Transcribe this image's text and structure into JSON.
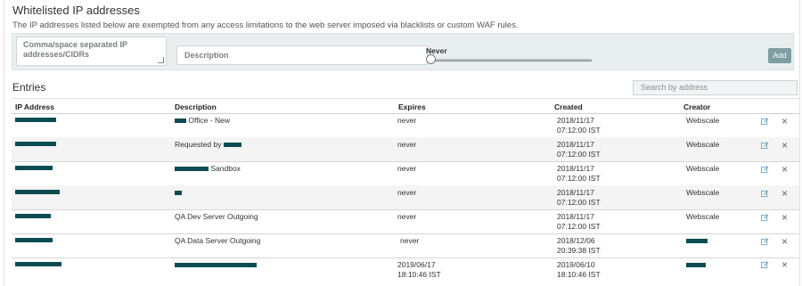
{
  "header": {
    "title": "Whitelisted IP addresses",
    "subtitle": "The IP addresses listed below are exempted from any access limitations to the web server imposed via blacklists or custom WAF rules."
  },
  "form": {
    "ips_placeholder": "Comma/space separated IP addresses/CIDRs",
    "description_placeholder": "Description",
    "expiry_label": "Never",
    "expiry_level": 0,
    "add_label": "Add"
  },
  "entries": {
    "title": "Entries",
    "search_placeholder": "Search by address",
    "columns": [
      "IP Address",
      "Description",
      "Expires",
      "Created",
      "Creator"
    ],
    "rows": [
      {
        "description": "Office - New",
        "expires": "never",
        "created_date": "2018/11/17",
        "created_time": "07:12:00 IST",
        "creator": "Webscale"
      },
      {
        "description": "Requested by",
        "expires": "never",
        "created_date": "2018/11/17",
        "created_time": "07:12:00 IST",
        "creator": "Webscale"
      },
      {
        "description": "Sandbox",
        "expires": "never",
        "created_date": "2018/11/17",
        "created_time": "07:12:00 IST",
        "creator": "Webscale"
      },
      {
        "description": "",
        "expires": "never",
        "created_date": "2018/11/17",
        "created_time": "07:12:00 IST",
        "creator": "Webscale"
      },
      {
        "description": "QA Dev Server Outgoing",
        "expires": "never",
        "created_date": "2018/11/17",
        "created_time": "07:12:00 IST",
        "creator": "Webscale"
      },
      {
        "description": "QA Data Server Outgoing",
        "expires": "never",
        "created_date": "2018/12/06",
        "created_time": "20:39:38 IST",
        "creator": ""
      },
      {
        "description": "",
        "expires_date": "2019/06/17",
        "expires_time": "18:10:46 IST",
        "created_date": "2019/06/10",
        "created_time": "18:10:46 IST",
        "creator": ""
      }
    ]
  },
  "colors": {
    "redaction": "#0c4d52",
    "form_bg": "#e9eff0",
    "add_button": "#7e9ea2",
    "icon_edit": "#6aa6c8"
  },
  "icons": [
    "edit-icon",
    "close-icon",
    "resize-grip-icon"
  ]
}
